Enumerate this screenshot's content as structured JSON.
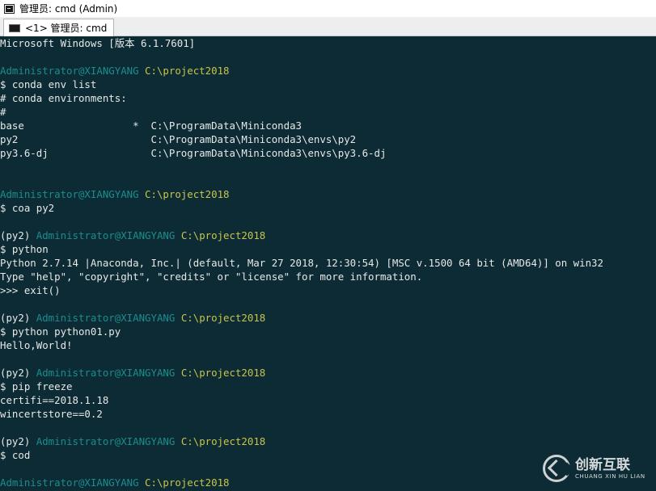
{
  "window": {
    "title": "管理员: cmd (Admin)",
    "app_icon": "console-icon"
  },
  "tabs": [
    {
      "label": "<1> 管理员: cmd",
      "icon": "console-icon",
      "active": true
    }
  ],
  "colors": {
    "background": "#0c2b34",
    "user_host": "#1b8d8d",
    "path": "#c9c44a",
    "text": "#e8e8e8"
  },
  "console": {
    "lines": [
      [
        {
          "t": "Microsoft Windows [版本 6.1.7601]",
          "c": "text"
        }
      ],
      [],
      [
        {
          "t": "Administrator@XIANGYANG ",
          "c": "user"
        },
        {
          "t": "C:\\project2018",
          "c": "path"
        }
      ],
      [
        {
          "t": "$ conda env list",
          "c": "text"
        }
      ],
      [
        {
          "t": "# conda environments:",
          "c": "text"
        }
      ],
      [
        {
          "t": "#",
          "c": "text"
        }
      ],
      [
        {
          "t": "base                  *  C:\\ProgramData\\Miniconda3",
          "c": "text"
        }
      ],
      [
        {
          "t": "py2                      C:\\ProgramData\\Miniconda3\\envs\\py2",
          "c": "text"
        }
      ],
      [
        {
          "t": "py3.6-dj                 C:\\ProgramData\\Miniconda3\\envs\\py3.6-dj",
          "c": "text"
        }
      ],
      [],
      [],
      [
        {
          "t": "Administrator@XIANGYANG ",
          "c": "user"
        },
        {
          "t": "C:\\project2018",
          "c": "path"
        }
      ],
      [
        {
          "t": "$ coa py2",
          "c": "text"
        }
      ],
      [],
      [
        {
          "t": "(py2) ",
          "c": "text"
        },
        {
          "t": "Administrator@XIANGYANG ",
          "c": "user"
        },
        {
          "t": "C:\\project2018",
          "c": "path"
        }
      ],
      [
        {
          "t": "$ python",
          "c": "text"
        }
      ],
      [
        {
          "t": "Python 2.7.14 |Anaconda, Inc.| (default, Mar 27 2018, 12:30:54) [MSC v.1500 64 bit (AMD64)] on win32",
          "c": "text"
        }
      ],
      [
        {
          "t": "Type \"help\", \"copyright\", \"credits\" or \"license\" for more information.",
          "c": "text"
        }
      ],
      [
        {
          "t": ">>> exit()",
          "c": "text"
        }
      ],
      [],
      [
        {
          "t": "(py2) ",
          "c": "text"
        },
        {
          "t": "Administrator@XIANGYANG ",
          "c": "user"
        },
        {
          "t": "C:\\project2018",
          "c": "path"
        }
      ],
      [
        {
          "t": "$ python python01.py",
          "c": "text"
        }
      ],
      [
        {
          "t": "Hello,World!",
          "c": "text"
        }
      ],
      [],
      [
        {
          "t": "(py2) ",
          "c": "text"
        },
        {
          "t": "Administrator@XIANGYANG ",
          "c": "user"
        },
        {
          "t": "C:\\project2018",
          "c": "path"
        }
      ],
      [
        {
          "t": "$ pip freeze",
          "c": "text"
        }
      ],
      [
        {
          "t": "certifi==2018.1.18",
          "c": "text"
        }
      ],
      [
        {
          "t": "wincertstore==0.2",
          "c": "text"
        }
      ],
      [],
      [
        {
          "t": "(py2) ",
          "c": "text"
        },
        {
          "t": "Administrator@XIANGYANG ",
          "c": "user"
        },
        {
          "t": "C:\\project2018",
          "c": "path"
        }
      ],
      [
        {
          "t": "$ cod",
          "c": "text"
        }
      ],
      [],
      [
        {
          "t": "Administrator@XIANGYANG ",
          "c": "user"
        },
        {
          "t": "C:\\project2018",
          "c": "path"
        }
      ]
    ]
  },
  "watermark": {
    "main": "创新互联",
    "sub": "CHUANG XIN HU LIAN",
    "icon": "brand-logo-icon"
  }
}
